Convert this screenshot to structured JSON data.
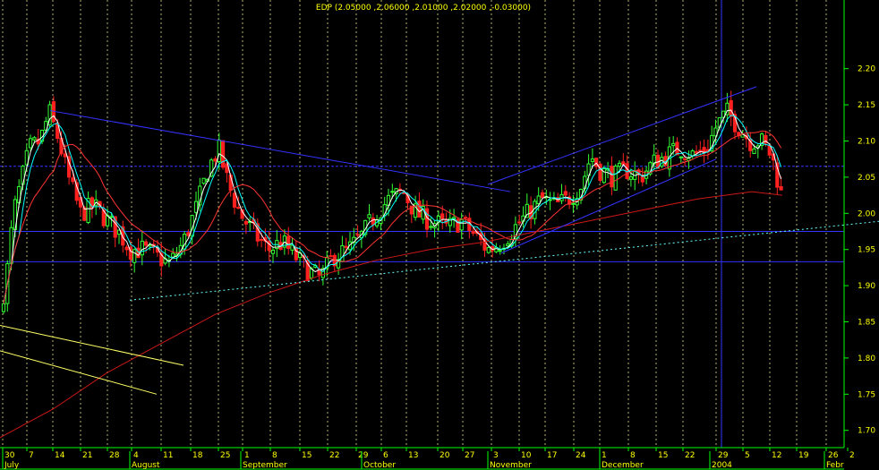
{
  "chart_data": {
    "type": "candlestick",
    "title": "EDP (2.05000 ,2.06000 ,2.01000 ,2.02000 ,-0.03000)",
    "ylim": [
      1.65,
      2.22
    ],
    "y_ticks": [
      "2.20",
      "2.15",
      "2.10",
      "2.05",
      "2.00",
      "1.95",
      "1.90",
      "1.85",
      "1.80",
      "1.75",
      "1.70"
    ],
    "x_ticks": [
      "30",
      "7",
      "14",
      "21",
      "28",
      "4",
      "11",
      "18",
      "25",
      "1",
      "8",
      "15",
      "22",
      "29",
      "6",
      "13",
      "20",
      "27",
      "3",
      "10",
      "17",
      "24",
      "1",
      "8",
      "15",
      "22",
      "29",
      "5",
      "12",
      "19",
      "26",
      "2"
    ],
    "months": [
      "July",
      "August",
      "September",
      "October",
      "November",
      "December",
      "2004",
      "Febr"
    ],
    "grid": true,
    "colors": {
      "background": "#000000",
      "up": "#33ff33",
      "down": "#ff2020",
      "ma_short": "#ffffff",
      "ma_fast": "#00ffff",
      "ma_mid": "#ff3333",
      "ma_long": "#cc1818",
      "trendline": "#3333ff",
      "support_dotted": "#66ffff",
      "channel": "#ffff66",
      "grid": "#ffff99",
      "axis": "#00ff00",
      "label": "#ffff00",
      "title": "#ffff00"
    },
    "horizontal_lines": [
      2.065,
      1.975,
      1.933
    ],
    "key_prices": {
      "start": 1.86,
      "aug_high": 2.14,
      "aug_low": 1.88,
      "sep_high": 2.09,
      "sep_low": 1.9,
      "dec_high": 2.09,
      "jan_high": 2.16,
      "last_close": 2.02
    },
    "ohlc_note": "last bar: open 2.05, high 2.06, low 2.01, close 2.02"
  }
}
